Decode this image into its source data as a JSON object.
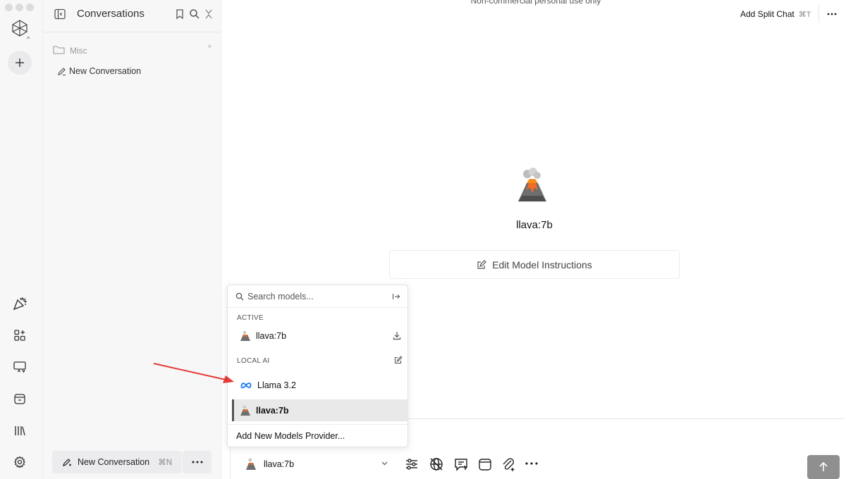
{
  "banner": {
    "text": "Non-commercial personal use only"
  },
  "sidebar": {
    "title": "Conversations",
    "folder": {
      "name": "Misc"
    },
    "conversations": [
      {
        "label": "New Conversation"
      }
    ],
    "footer": {
      "new_label": "New Conversation",
      "new_shortcut": "⌘N"
    }
  },
  "header": {
    "split_chat_label": "Add Split Chat",
    "split_chat_shortcut": "⌘T"
  },
  "main": {
    "model_name": "llava:7b",
    "edit_instructions_label": "Edit Model Instructions"
  },
  "dropdown": {
    "search_placeholder": "Search models...",
    "sections": [
      {
        "title": "ACTIVE",
        "items": [
          {
            "label": "llava:7b",
            "icon": "volcano-icon"
          }
        ]
      },
      {
        "title": "LOCAL AI",
        "items": [
          {
            "label": "Llama 3.2",
            "icon": "meta-icon"
          },
          {
            "label": "llava:7b",
            "icon": "volcano-icon",
            "selected": true
          }
        ]
      }
    ],
    "footer_label": "Add New Models Provider..."
  },
  "composer": {
    "selected_model": "llava:7b"
  },
  "colors": {
    "sidebar_bg": "#f7f7f8",
    "selected_bg": "#e9e9ea",
    "send_button": "#8f8f8f",
    "meta_blue": "#1877f2",
    "annotation_arrow": "#e53935"
  }
}
